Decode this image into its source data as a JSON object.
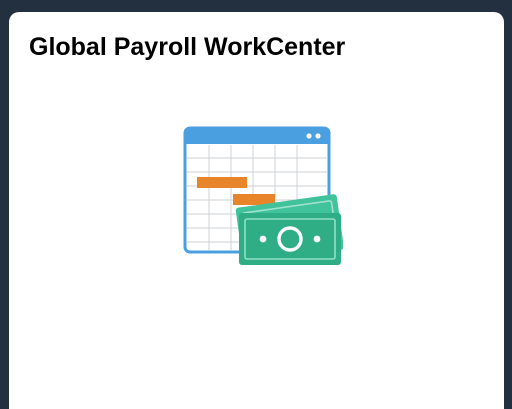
{
  "tile": {
    "title": "Global Payroll WorkCenter",
    "icon": "calendar-with-money-icon"
  },
  "colors": {
    "calendar_blue": "#4a9fe0",
    "bar_orange": "#e8852a",
    "money_green": "#2fae86",
    "money_dark_green": "#1f8c69"
  }
}
